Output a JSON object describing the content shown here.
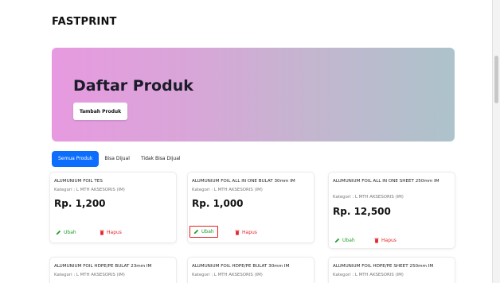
{
  "brand": "FASTPRINT",
  "hero": {
    "title": "Daftar Produk",
    "add_button": "Tambah Produk"
  },
  "tabs": [
    {
      "label": "Semua Produk",
      "active": true
    },
    {
      "label": "Bisa Dijual",
      "active": false
    },
    {
      "label": "Tidak Bisa Dijual",
      "active": false
    }
  ],
  "actions": {
    "edit": "Ubah",
    "delete": "Hapus"
  },
  "products": [
    {
      "name": "ALUMUNIUM FOIL TES",
      "category": "Kategori : L MTH AKSESORIS (IM)",
      "price": "Rp. 1,200"
    },
    {
      "name": "ALUMUNIUM FOIL ALL IN ONE BULAT 30mm IM",
      "category": "Kategori : L MTH AKSESORIS (IM)",
      "price": "Rp. 1,000"
    },
    {
      "name": "ALUMUNIUM FOIL ALL IN ONE SHEET 250mm IM",
      "category": "Kategori : L MTH AKSESORIS (IM)",
      "price": "Rp. 12,500"
    },
    {
      "name": "ALUMUNIUM FOIL HDPE/PE BULAT 23mm IM",
      "category": "Kategori : L MTH AKSESORIS (IM)",
      "price": ""
    },
    {
      "name": "ALUMUNIUM FOIL HDPE/PE BULAT 30mm IM",
      "category": "Kategori : L MTH AKSESORIS (IM)",
      "price": ""
    },
    {
      "name": "ALUMUNIUM FOIL HDPE/PE SHEET 250mm IM",
      "category": "Kategori : L MTH AKSESORIS (IM)",
      "price": ""
    }
  ],
  "colors": {
    "primary": "#0d6efd",
    "edit": "#1f9d2b",
    "delete": "#e3262e",
    "highlight": "#e02020"
  }
}
